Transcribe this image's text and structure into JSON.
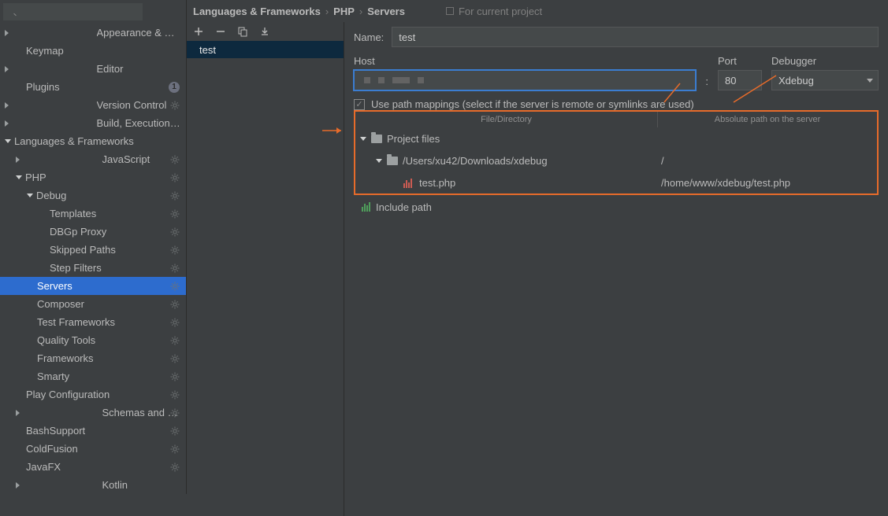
{
  "search": {
    "placeholder": ""
  },
  "sidebar": {
    "items": [
      {
        "label": "Appearance & Behavior",
        "arrow": "right",
        "indent": 0,
        "gear": false
      },
      {
        "label": "Keymap",
        "arrow": "none",
        "indent": 1,
        "gear": false
      },
      {
        "label": "Editor",
        "arrow": "right",
        "indent": 0,
        "gear": false
      },
      {
        "label": "Plugins",
        "arrow": "none",
        "indent": 1,
        "gear": false,
        "badge": "1"
      },
      {
        "label": "Version Control",
        "arrow": "right",
        "indent": 0,
        "gear": true
      },
      {
        "label": "Build, Execution, Deployment",
        "arrow": "right",
        "indent": 0,
        "gear": false
      },
      {
        "label": "Languages & Frameworks",
        "arrow": "down",
        "indent": 0,
        "gear": false
      },
      {
        "label": "JavaScript",
        "arrow": "right",
        "indent": 1,
        "gear": true
      },
      {
        "label": "PHP",
        "arrow": "down",
        "indent": 1,
        "gear": true
      },
      {
        "label": "Debug",
        "arrow": "down",
        "indent": 2,
        "gear": true
      },
      {
        "label": "Templates",
        "arrow": "none",
        "indent": 3,
        "gear": true
      },
      {
        "label": "DBGp Proxy",
        "arrow": "none",
        "indent": 3,
        "gear": true
      },
      {
        "label": "Skipped Paths",
        "arrow": "none",
        "indent": 3,
        "gear": true
      },
      {
        "label": "Step Filters",
        "arrow": "none",
        "indent": 3,
        "gear": true
      },
      {
        "label": "Servers",
        "arrow": "none",
        "indent": 2,
        "gear": true,
        "selected": true
      },
      {
        "label": "Composer",
        "arrow": "none",
        "indent": 2,
        "gear": true
      },
      {
        "label": "Test Frameworks",
        "arrow": "none",
        "indent": 2,
        "gear": true
      },
      {
        "label": "Quality Tools",
        "arrow": "none",
        "indent": 2,
        "gear": true
      },
      {
        "label": "Frameworks",
        "arrow": "none",
        "indent": 2,
        "gear": true
      },
      {
        "label": "Smarty",
        "arrow": "none",
        "indent": 2,
        "gear": true
      },
      {
        "label": "Play Configuration",
        "arrow": "none",
        "indent": 1,
        "gear": true
      },
      {
        "label": "Schemas and DTDs",
        "arrow": "right",
        "indent": 1,
        "gear": true
      },
      {
        "label": "BashSupport",
        "arrow": "none",
        "indent": 1,
        "gear": true
      },
      {
        "label": "ColdFusion",
        "arrow": "none",
        "indent": 1,
        "gear": true
      },
      {
        "label": "JavaFX",
        "arrow": "none",
        "indent": 1,
        "gear": true
      },
      {
        "label": "Kotlin",
        "arrow": "right",
        "indent": 1,
        "gear": false
      }
    ]
  },
  "breadcrumb": {
    "a": "Languages & Frameworks",
    "b": "PHP",
    "c": "Servers"
  },
  "project_hint": "For current project",
  "server_list": {
    "items": [
      {
        "name": "test",
        "selected": true
      }
    ]
  },
  "form": {
    "name_label": "Name:",
    "name_value": "test",
    "host_label": "Host",
    "port_label": "Port",
    "port_value": "80",
    "debugger_label": "Debugger",
    "debugger_value": "Xdebug",
    "use_path_mappings_checked": true,
    "use_path_mappings_label": "Use path mappings (select if the server is remote or symlinks are used)"
  },
  "mapping": {
    "col1": "File/Directory",
    "col2": "Absolute path on the server",
    "rows": [
      {
        "indent": 0,
        "icon": "folder",
        "arrow": "down",
        "label": "Project files",
        "remote": ""
      },
      {
        "indent": 1,
        "icon": "folder",
        "arrow": "down",
        "label": "/Users/xu42/Downloads/xdebug",
        "remote": "/"
      },
      {
        "indent": 2,
        "icon": "php",
        "arrow": "none",
        "label": "test.php",
        "remote": "/home/www/xdebug/test.php"
      }
    ],
    "include_label": "Include path"
  }
}
